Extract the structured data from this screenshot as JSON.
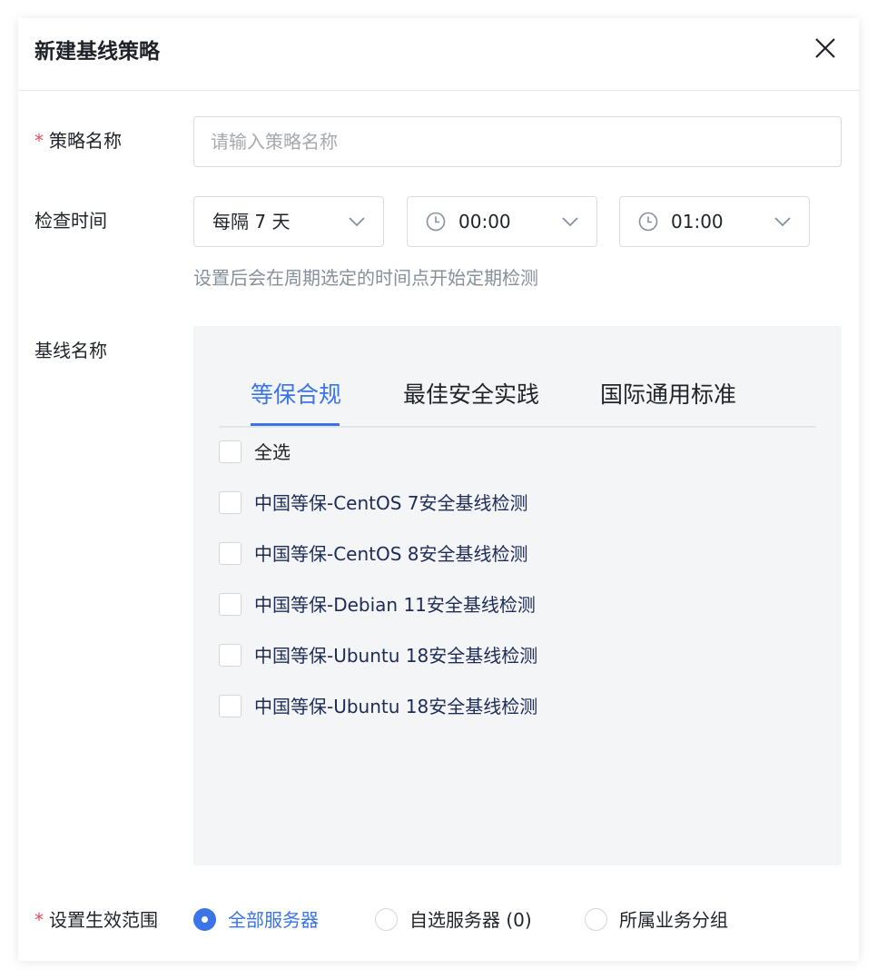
{
  "dialog": {
    "title": "新建基线策略",
    "close_icon": "close-icon"
  },
  "form": {
    "required_mark": "*",
    "name": {
      "label": "策略名称",
      "value": "",
      "placeholder": "请输入策略名称"
    },
    "check_time": {
      "label": "检查时间",
      "interval": "每隔 7 天",
      "start_time": "00:00",
      "end_time": "01:00",
      "hint": "设置后会在周期选定的时间点开始定期检测"
    },
    "baseline": {
      "label": "基线名称",
      "tabs": [
        "等保合规",
        "最佳安全实践",
        "国际通用标准"
      ],
      "active_tab": 0,
      "select_all": "全选",
      "items": [
        "中国等保-CentOS 7安全基线检测",
        "中国等保-CentOS 8安全基线检测",
        "中国等保-Debian 11安全基线检测",
        "中国等保-Ubuntu 18安全基线检测",
        "中国等保-Ubuntu 18安全基线检测"
      ]
    },
    "scope": {
      "label": "设置生效范围",
      "options": [
        "全部服务器",
        "自选服务器 (0)",
        "所属业务分组"
      ],
      "selected": 0
    }
  },
  "colors": {
    "accent": "#3a74e6",
    "required": "#e34d59",
    "panel_bg": "#f4f5f7",
    "hint": "#86909c"
  }
}
